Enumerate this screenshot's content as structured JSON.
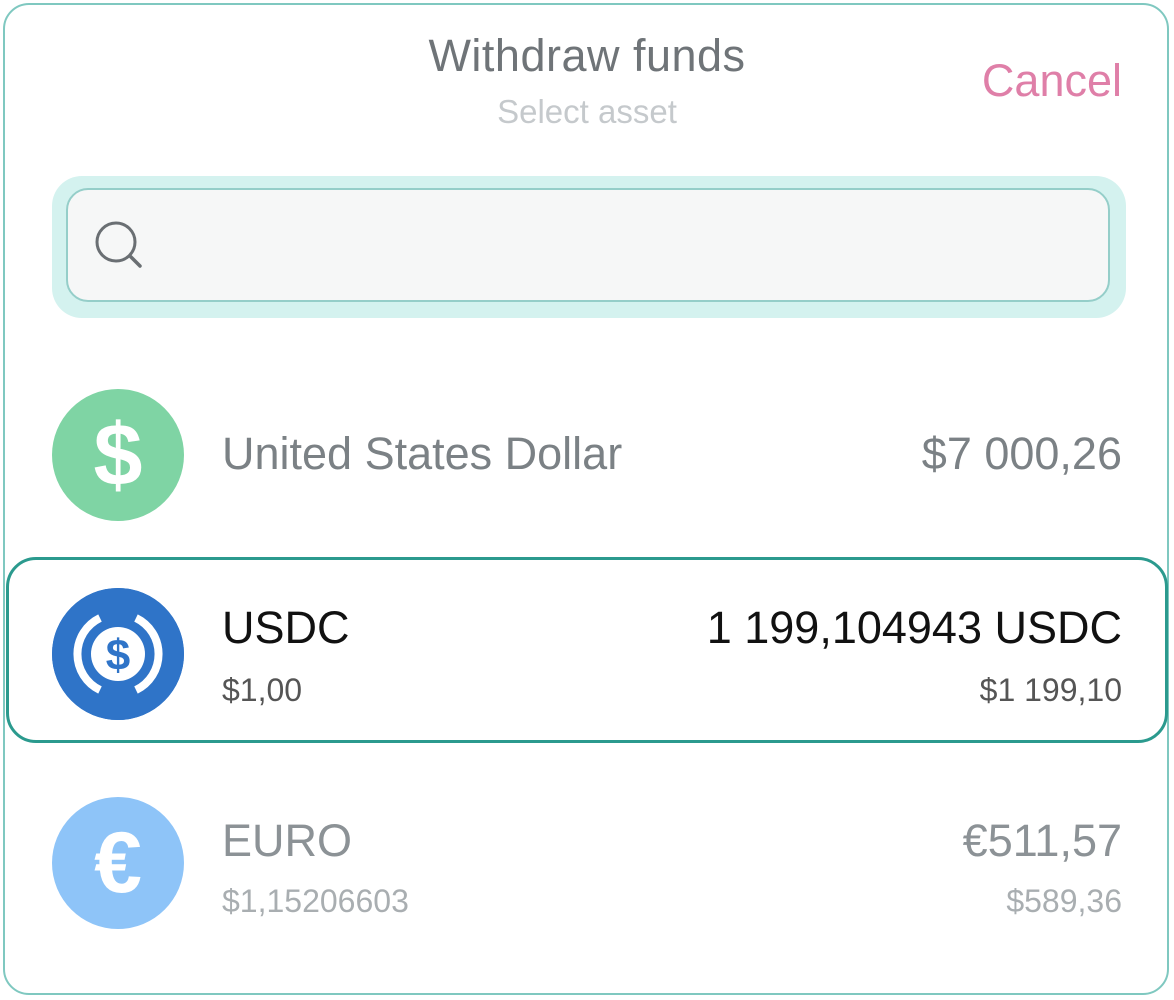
{
  "header": {
    "title": "Withdraw funds",
    "subtitle": "Select asset",
    "cancel_label": "Cancel"
  },
  "search": {
    "placeholder": "",
    "value": "",
    "icon": "search-icon"
  },
  "assets": [
    {
      "name": "United States Dollar",
      "balance": "$7 000,26",
      "icon": "dollar-icon",
      "icon_color": "#7fd4a4",
      "icon_symbol": "$"
    },
    {
      "name": "USDC",
      "price": "$1,00",
      "balance": "1 199,104943 USDC",
      "balance_fiat": "$1 199,10",
      "icon": "usdc-icon",
      "icon_color": "#2f74c8",
      "selected": true
    },
    {
      "name": "EURO",
      "price": "$1,15206603",
      "balance": "€511,57",
      "balance_fiat": "$589,36",
      "icon": "euro-icon",
      "icon_color": "#8ec4f8",
      "icon_symbol": "€"
    }
  ],
  "colors": {
    "accent": "#2b9a8e",
    "cancel": "#df7fa8",
    "search_glow": "#d4f2ef"
  }
}
